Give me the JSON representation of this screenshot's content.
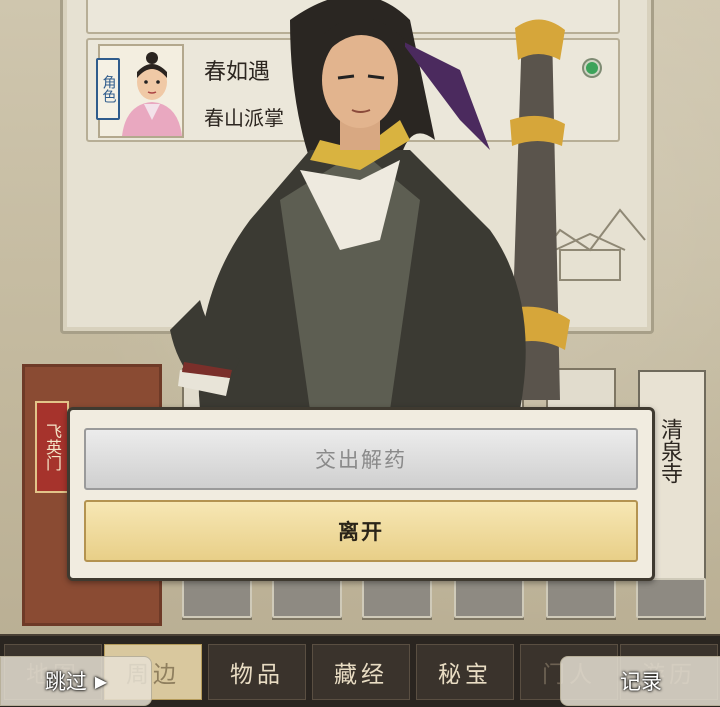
{
  "character_card": {
    "role_tag": "角色",
    "name": "春如遇",
    "title": "春山派掌"
  },
  "locations": {
    "left_sect": "飞英门",
    "right_temple": "清泉寺"
  },
  "dialog": {
    "option_1": "交出解药",
    "option_2": "离开"
  },
  "tabs": [
    {
      "label": "地图"
    },
    {
      "label": "周边"
    },
    {
      "label": "物品"
    },
    {
      "label": "藏经"
    },
    {
      "label": "秘宝"
    },
    {
      "label": "门人"
    },
    {
      "label": "游历"
    }
  ],
  "skip_button": "跳过",
  "log_button": "记录",
  "colors": {
    "leave_button": "#e8cf88",
    "disabled_button": "#cfcfcf",
    "tab_bar": "#2a2520",
    "status_dot": "#3ca35a"
  }
}
